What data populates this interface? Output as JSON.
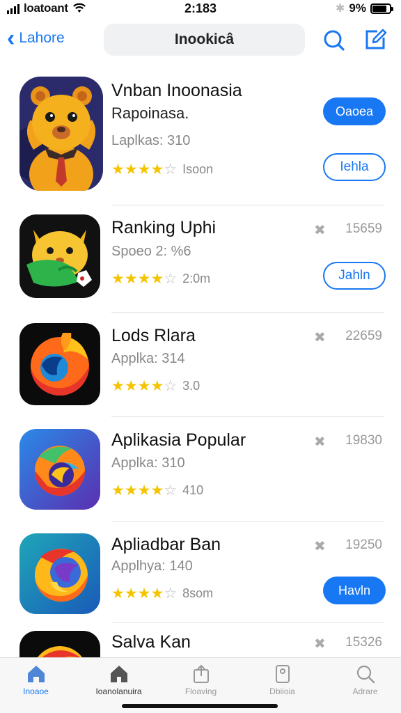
{
  "status_bar": {
    "carrier": "loatoant",
    "time": "2:183",
    "battery_percent": "9%",
    "battery_level": 0.85
  },
  "nav": {
    "back_label": "Lahore",
    "title": "Inookicâ",
    "icons": [
      "search-icon",
      "compose-icon"
    ]
  },
  "apps": [
    {
      "name": "Vnban Inoonasia",
      "subtitle": "Rapoinasa.",
      "meta": "Laplkas: 310",
      "rating": 4,
      "rating_count": "Isoon",
      "buttons": [
        "Oaoea",
        "Iehla"
      ],
      "icon": "bear-mascot-icon"
    },
    {
      "name": "Ranking Uphi",
      "meta": "Spoeo 2: %6",
      "rating": 4,
      "rating_count": "2:0m",
      "size": "15659",
      "button": "Jahln",
      "icon": "cat-mascot-icon"
    },
    {
      "name": "Lods Rlara",
      "meta": "Applka: 314",
      "rating": 4,
      "rating_count": "3.0",
      "size": "22659",
      "icon": "fox-logo-icon"
    },
    {
      "name": "Aplikasia Popular",
      "meta": "Applka: 310",
      "rating": 4,
      "rating_count": "410",
      "size": "19830",
      "icon": "swirl-logo-icon"
    },
    {
      "name": "Apliadbar Ban",
      "meta": "Applhya: 140",
      "rating": 4,
      "rating_count": "8som",
      "size": "19250",
      "button": "Havln",
      "icon": "globe-flame-icon"
    },
    {
      "name": "Salva Kan",
      "size": "15326",
      "icon": "flame-logo-icon"
    }
  ],
  "tabs": [
    {
      "label": "Inoaoe",
      "icon": "home-icon",
      "state": "active"
    },
    {
      "label": "Ioanolanuira",
      "icon": "store-icon",
      "state": "dark"
    },
    {
      "label": "Floaving",
      "icon": "share-icon",
      "state": "normal"
    },
    {
      "label": "Dbiioia",
      "icon": "device-icon",
      "state": "normal"
    },
    {
      "label": "Adrare",
      "icon": "search-icon",
      "state": "normal"
    }
  ],
  "colors": {
    "accent": "#1877f2",
    "star": "#f5c400",
    "muted": "#888888"
  }
}
